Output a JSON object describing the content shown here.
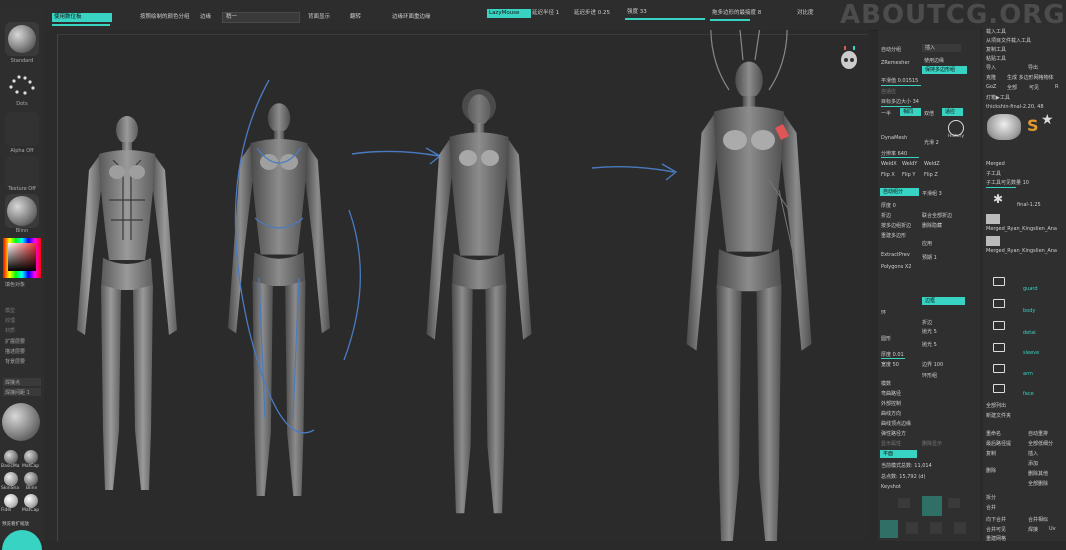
{
  "watermark": "ABOUTCG.ORG",
  "colors": {
    "accent": "#38d3c2",
    "bg": "#2b2b2b",
    "panel": "#2f2f2f",
    "mark": "#e05555"
  },
  "topbar": {
    "btn_active_left": "使用数位板",
    "btn_color_group": "按照绘制的颜色分组",
    "lbl_edge": "边缘",
    "val_edge": "稍一",
    "lbl_display_back": "背面显示",
    "lbl_flip": "翻转",
    "lbl_edge_loop": "边缘环面重边缘",
    "btn_lazymouse": "LazyMouse",
    "lbl_lazy_step": "延迟半径 1",
    "lbl_lazy_step2": "延迟步进 0.25",
    "lbl_strength": "强度 33",
    "lbl_brush_radius": "拖多边形的最接度 8",
    "lbl_symmetry": "对比度"
  },
  "leftshelf": {
    "brush_standard": "Standard",
    "brush_dots": "Dots",
    "alpha": "Alpha Off",
    "texture": "Texture Off",
    "material": "Blinn",
    "color_label": "填色对象",
    "menu_1": "模型",
    "menu_2": "纹理",
    "menu_3": "材质",
    "menu_4": "扩展层要",
    "menu_5": "描述层要",
    "menu_6": "背景层要",
    "dropdown_1": "焊接点",
    "dropdown_2": "焊接间距 1",
    "mat_1": "BasicMa",
    "mat_2": "MatCap",
    "mat_3": "SkinSha",
    "mat_4": "Blinn",
    "mat_5": "Fidel",
    "mat_6": "MatCap",
    "bottom": "预览看扩缩放"
  },
  "rp1": {
    "auto_group": "自动分组",
    "insert": "插入",
    "zremesher": "ZRemesher",
    "use_poly": "使用边缘",
    "keep_groups": "保持多边形组",
    "smooth_factor": "平滑值 0.01515",
    "adaptive": "自适应",
    "target_poly": "目标多边大小 34",
    "half": "一半",
    "same": "相同",
    "double": "双倍",
    "adapt": "适应",
    "history": "History",
    "dynamesh": "DynaMesh",
    "subdiv": "光滑 2",
    "resolution": "分辨率 640",
    "weld": "焊接",
    "weldx": "WeldX",
    "weldy": "WeldY",
    "weldz": "WeldZ",
    "flipx": "Flip X",
    "flipy": "Flip Y",
    "flipz": "Flip Z",
    "auto_groups": "自动组分",
    "smooth_groups": "平滑组 3",
    "thickness": "厚度 0",
    "split": "折边",
    "flatten_all": "联合全部折边",
    "polish_groups": "按多边组折边",
    "delete_hidden": "删除隐藏",
    "rebuild": "重建多边形",
    "apply": "应用",
    "extract_prev": "ExtractPrev",
    "preview_1": "预期 1",
    "polygons": "Polygons X2",
    "edge_loop": "边框",
    "loop_1": "环",
    "grouped": "折边",
    "polish_5": "抛光 5",
    "polish_5b": "抛光 5",
    "spiral": "圆形",
    "thickness2": "厚度 0.01",
    "width_50": "宽度 50",
    "border_100": "边界 100",
    "loop_2": "环形组",
    "topo_item": "模数",
    "item_2": "弯曲路径",
    "item_3": "外部控制",
    "item_4": "曲线方向",
    "item_5": "曲线顶点边缘",
    "item_6": "弹性路径方",
    "item_7": "曲线路径方",
    "display_props": "显示属性",
    "flat": "平面",
    "tris_count": "当前模式总数: 11,014",
    "points_count": "总点数: 15,792 (d)",
    "keyshot": "Keyshot",
    "label_end": "删除显示"
  },
  "rp2": {
    "item_1": "载入工具",
    "item_2": "从项目文件载入工具",
    "item_3": "复制工具",
    "item_4": "粘贴工具",
    "import": "导入",
    "export": "导出",
    "clone": "克隆",
    "create_multi": "生成 多边形网格物体",
    "goz": "GoZ",
    "all": "全部",
    "visible": "可见",
    "r": "R",
    "lightbox": "灯箱▶工具",
    "tool_name": "thickshin-final-2.20, 48",
    "merged": "Merged",
    "subtool": "子工具",
    "subtool_count": "子工具可见数量 10",
    "layer_final": "final-1.25",
    "layer_merged1": "Merged_Ryan_Kingslien_Ana",
    "layer_merged2": "Merged_Ryan_Kingslien_Ana",
    "folder_guard": "guard",
    "folder_body": "body",
    "folder_detail": "detai",
    "folder_sleeve": "sleeve",
    "folder_arm": "arm",
    "folder_face": "face",
    "list_all": "全部列出",
    "new_folder": "新建文件夹",
    "rename": "重命名",
    "auto_reorder": "自动重排",
    "ladder": "最后路径提",
    "all_low": "全部低细分",
    "copy": "复制",
    "insert2": "插入",
    "append": "添加",
    "delete": "删除",
    "del_other": "删除其他",
    "del_all": "全部删除",
    "split_label": "拆分",
    "merge_label": "合并",
    "merge_down": "向下合并",
    "merge_similar": "合并相似",
    "merge_visible": "合并可见",
    "weld": "焊接",
    "uv": "Uv",
    "remesh": "重建网格",
    "project": "投射"
  }
}
